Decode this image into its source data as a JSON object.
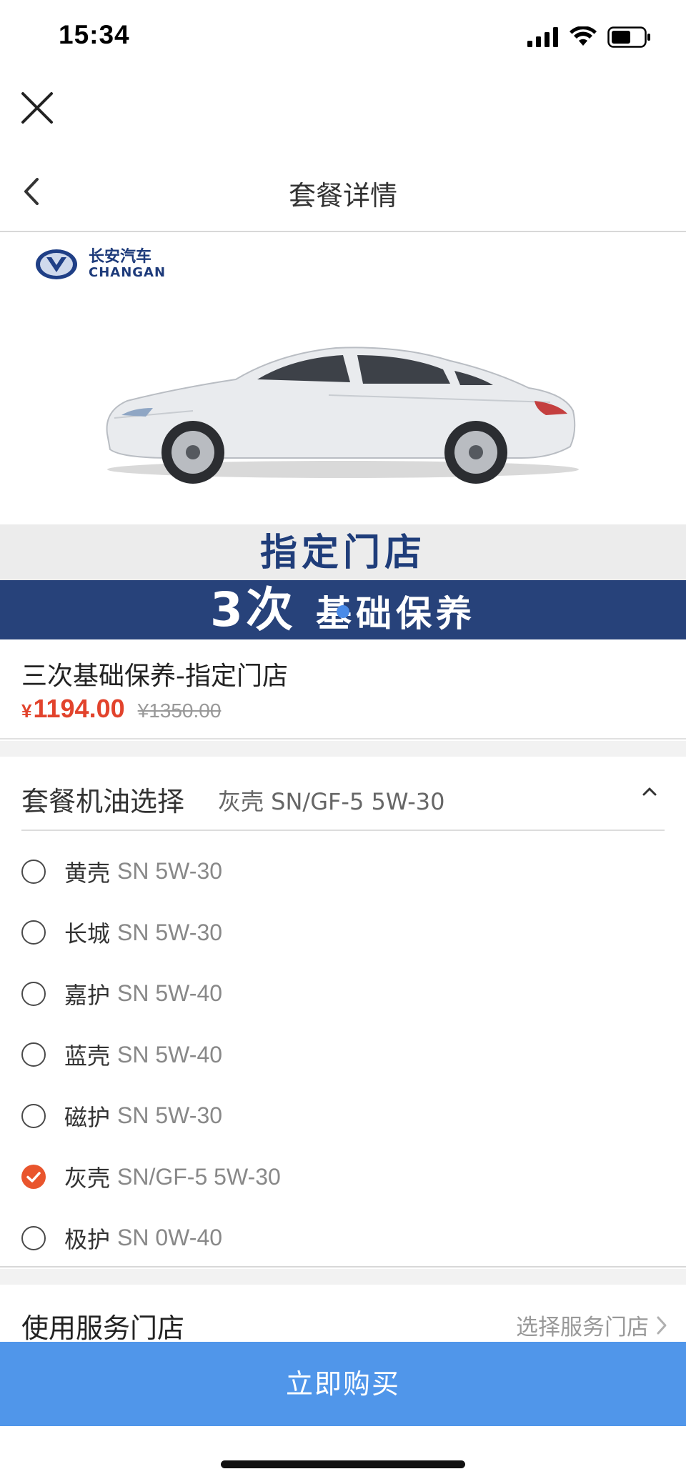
{
  "status_bar": {
    "time": "15:34"
  },
  "header": {
    "title": "套餐详情"
  },
  "banner": {
    "logo_cn": "长安汽车",
    "logo_en": "CHANGAN",
    "band1_text": "指定门店",
    "band2_big": "3次",
    "band2_small": "基础保养"
  },
  "product": {
    "title": "三次基础保养-指定门店",
    "price_symbol": "¥",
    "price": "1194.00",
    "original_price": "¥1350.00"
  },
  "oil_section": {
    "label": "套餐机油选择",
    "selected_value": "灰壳 SN/GF-5 5W-30",
    "options": [
      {
        "brand": "黄壳",
        "spec": "SN 5W-30",
        "checked": false
      },
      {
        "brand": "长城",
        "spec": "SN 5W-30",
        "checked": false
      },
      {
        "brand": "嘉护",
        "spec": "SN 5W-40",
        "checked": false
      },
      {
        "brand": "蓝壳",
        "spec": "SN 5W-40",
        "checked": false
      },
      {
        "brand": "磁护",
        "spec": "SN 5W-30",
        "checked": false
      },
      {
        "brand": "灰壳",
        "spec": "SN/GF-5 5W-30",
        "checked": true
      },
      {
        "brand": "极护",
        "spec": "SN 0W-40",
        "checked": false
      }
    ]
  },
  "store": {
    "label": "使用服务门店",
    "action": "选择服务门店"
  },
  "buy_button": {
    "label": "立即购买"
  },
  "colors": {
    "accent_blue": "#5096ea",
    "price_red": "#e2432c",
    "check_orange": "#e9552d",
    "banner_navy": "#27427a"
  }
}
